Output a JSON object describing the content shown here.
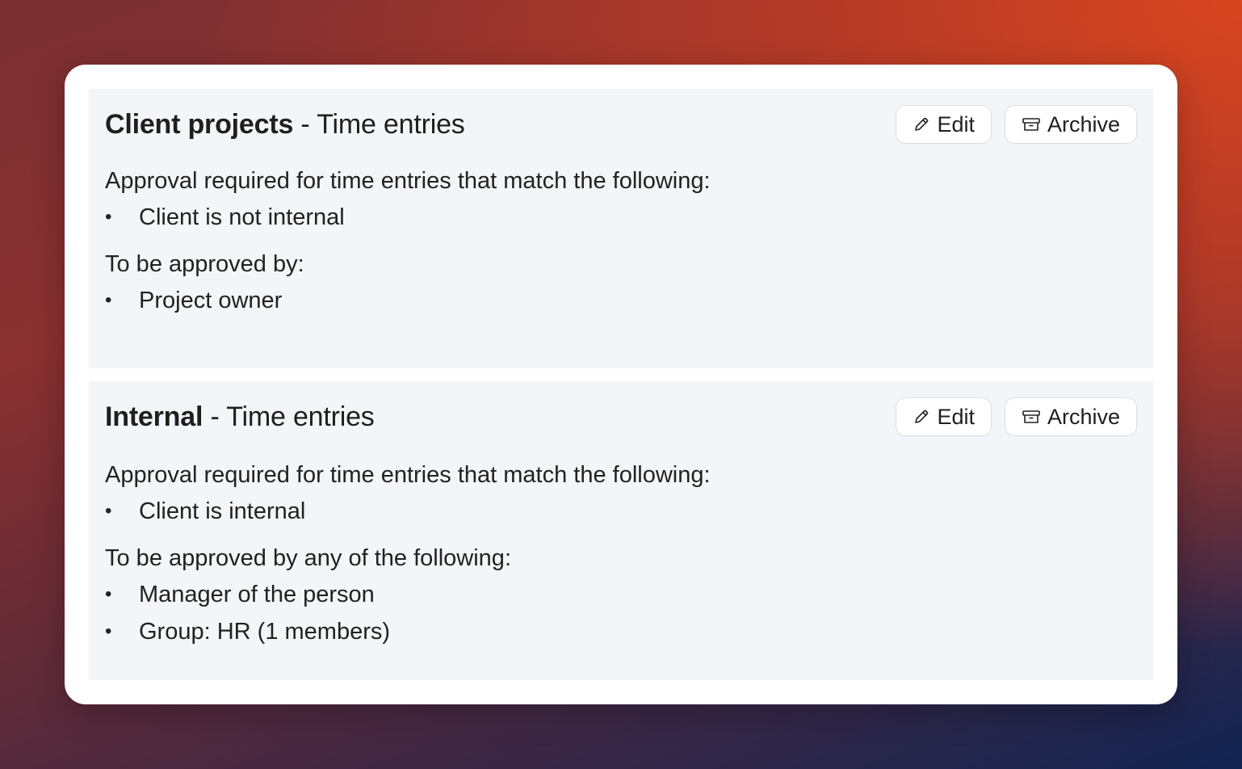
{
  "policies": [
    {
      "name": "Client projects",
      "separator": " - ",
      "kind": "Time entries",
      "edit_label": "Edit",
      "archive_label": "Archive",
      "match_heading": "Approval required for time entries that match the following:",
      "match_items": [
        "Client is not internal"
      ],
      "approver_heading": "To be approved by:",
      "approver_items": [
        "Project owner"
      ]
    },
    {
      "name": "Internal",
      "separator": " - ",
      "kind": "Time entries",
      "edit_label": "Edit",
      "archive_label": "Archive",
      "match_heading": "Approval required for time entries that match the following:",
      "match_items": [
        "Client is internal"
      ],
      "approver_heading": "To be approved by any of the following:",
      "approver_items": [
        "Manager of the person",
        "Group: HR (1 members)"
      ]
    }
  ],
  "icons": {
    "edit": "pencil-icon",
    "archive": "archive-box-icon"
  },
  "colors": {
    "panel_background": "#f4f5f9",
    "card_background": "#ffffff",
    "text": "#1f1f1f"
  }
}
